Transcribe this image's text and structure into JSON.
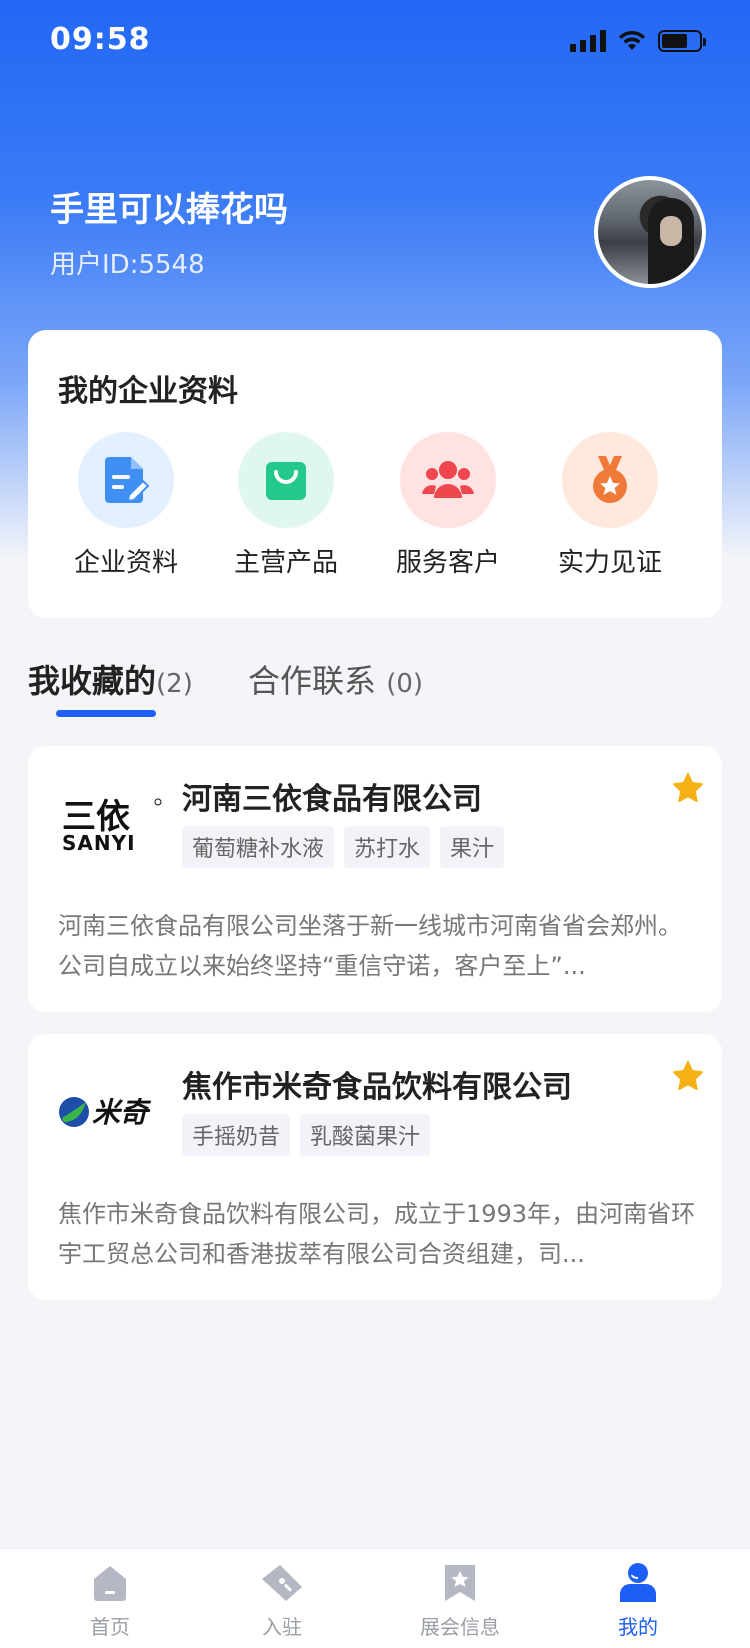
{
  "status": {
    "time": "09:58"
  },
  "user": {
    "name": "手里可以捧花吗",
    "id_text": "用户ID:5548"
  },
  "profile_section": {
    "title": "我的企业资料",
    "items": [
      {
        "label": "企业资料",
        "icon": "document-edit-icon",
        "bg": "#e3f0ff"
      },
      {
        "label": "主营产品",
        "icon": "shopping-bag-icon",
        "bg": "#dff7ee"
      },
      {
        "label": "服务客户",
        "icon": "users-icon",
        "bg": "#ffe3e3"
      },
      {
        "label": "实力见证",
        "icon": "medal-icon",
        "bg": "#ffe9dd"
      }
    ]
  },
  "tabs": {
    "favorites_label": "我收藏的",
    "favorites_count": "(2)",
    "cooperation_label": "合作联系",
    "cooperation_count": "(0)"
  },
  "favorites": [
    {
      "name": "河南三依食品有限公司",
      "logo_text": "三依",
      "logo_sub": "SANYI",
      "tags": [
        "葡萄糖补水液",
        "苏打水",
        "果汁"
      ],
      "description": "河南三依食品有限公司坐落于新一线城市河南省省会郑州。公司自成立以来始终坚持“重信守诺，客户至上”..."
    },
    {
      "name": "焦作市米奇食品饮料有限公司",
      "logo_text": "米奇",
      "tags": [
        "手摇奶昔",
        "乳酸菌果汁"
      ],
      "description": "焦作市米奇食品饮料有限公司，成立于1993年，由河南省环宇工贸总公司和香港拔萃有限公司合资组建，司..."
    }
  ],
  "bottom_nav": [
    {
      "label": "首页",
      "icon": "home-icon"
    },
    {
      "label": "入驻",
      "icon": "ticket-icon"
    },
    {
      "label": "展会信息",
      "icon": "bookmark-star-icon"
    },
    {
      "label": "我的",
      "icon": "person-icon"
    }
  ],
  "colors": {
    "primary": "#1d5ef5",
    "star": "#f5b014"
  }
}
